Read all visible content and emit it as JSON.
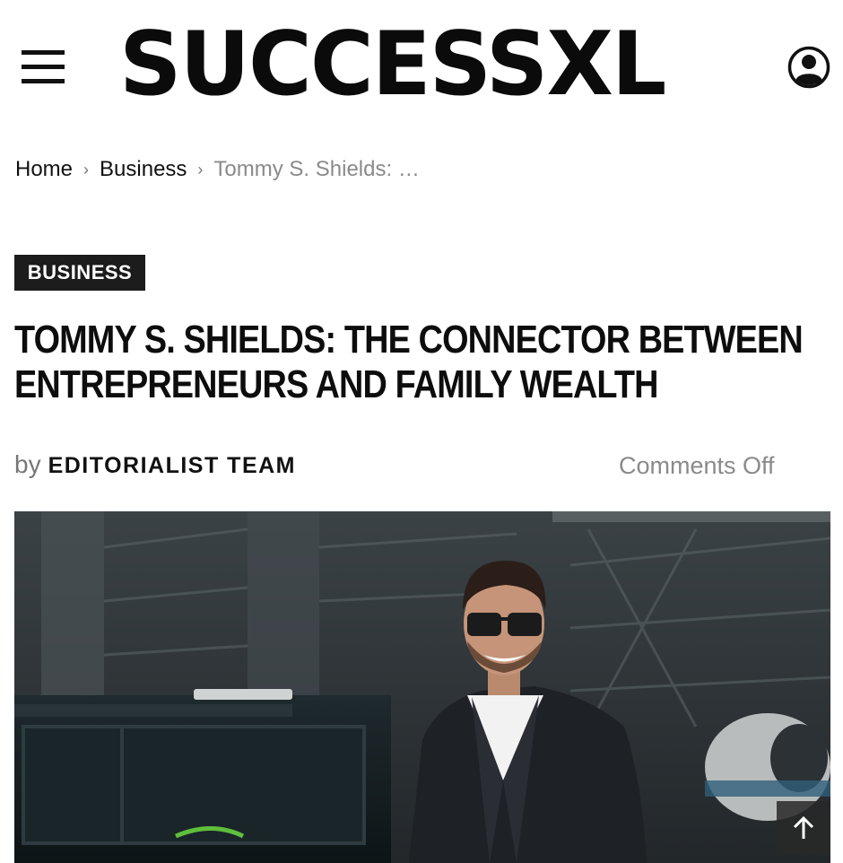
{
  "site": {
    "logo_text": "SUCCESSXL",
    "menu_icon": "hamburger-icon",
    "user_icon": "user-account-icon"
  },
  "breadcrumb": {
    "items": [
      {
        "label": "Home"
      },
      {
        "label": "Business"
      }
    ],
    "separator": "›",
    "current": "Tommy S. Shields: …"
  },
  "article": {
    "category": "BUSINESS",
    "title": "TOMMY S. SHIELDS: THE CONNECTOR BETWEEN ENTREPRENEURS AND FAMILY WEALTH",
    "by_prefix": "by",
    "author": "EDITORIALIST TEAM",
    "comments": "Comments Off",
    "hero_image": "featured-photo"
  },
  "back_to_top_icon": "arrow-up-icon",
  "colors": {
    "text": "#111111",
    "muted": "#8a8a8a",
    "badge_bg": "#1c1c1c",
    "badge_text": "#ffffff"
  }
}
